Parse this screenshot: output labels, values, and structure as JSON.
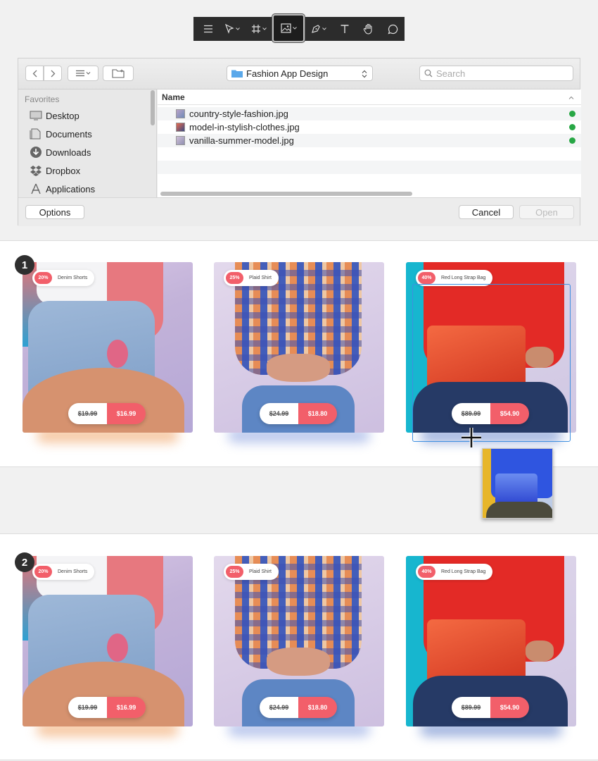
{
  "toolbar": {
    "tools": [
      "menu-icon",
      "move-tool-icon",
      "frame-tool-icon",
      "image-tool-icon",
      "pen-tool-icon",
      "text-tool-icon",
      "hand-tool-icon",
      "comment-tool-icon"
    ],
    "active_tool": "image-tool-icon"
  },
  "dialog": {
    "location": "Fashion App Design",
    "search_placeholder": "Search",
    "sidebar_heading": "Favorites",
    "sidebar_items": [
      "Desktop",
      "Documents",
      "Downloads",
      "Dropbox",
      "Applications"
    ],
    "column_name": "Name",
    "files": [
      "country-style-fashion.jpg",
      "model-in-stylish-clothes.jpg",
      "vanilla-summer-model.jpg"
    ],
    "options_label": "Options",
    "cancel_label": "Cancel",
    "open_label": "Open"
  },
  "steps": [
    "1",
    "2"
  ],
  "cards": [
    {
      "discount": "20%",
      "name": "Denim Shorts",
      "old_price": "$19.99",
      "new_price": "$16.99"
    },
    {
      "discount": "25%",
      "name": "Plaid Shirt",
      "old_price": "$24.99",
      "new_price": "$18.80"
    },
    {
      "discount": "40%",
      "name": "Red Long Strap Bag",
      "old_price": "$89.99",
      "new_price": "$54.90"
    }
  ],
  "colors": {
    "accent": "#f25f6a",
    "selection": "#3d8fe0",
    "toolbar": "#2c2c2c"
  }
}
